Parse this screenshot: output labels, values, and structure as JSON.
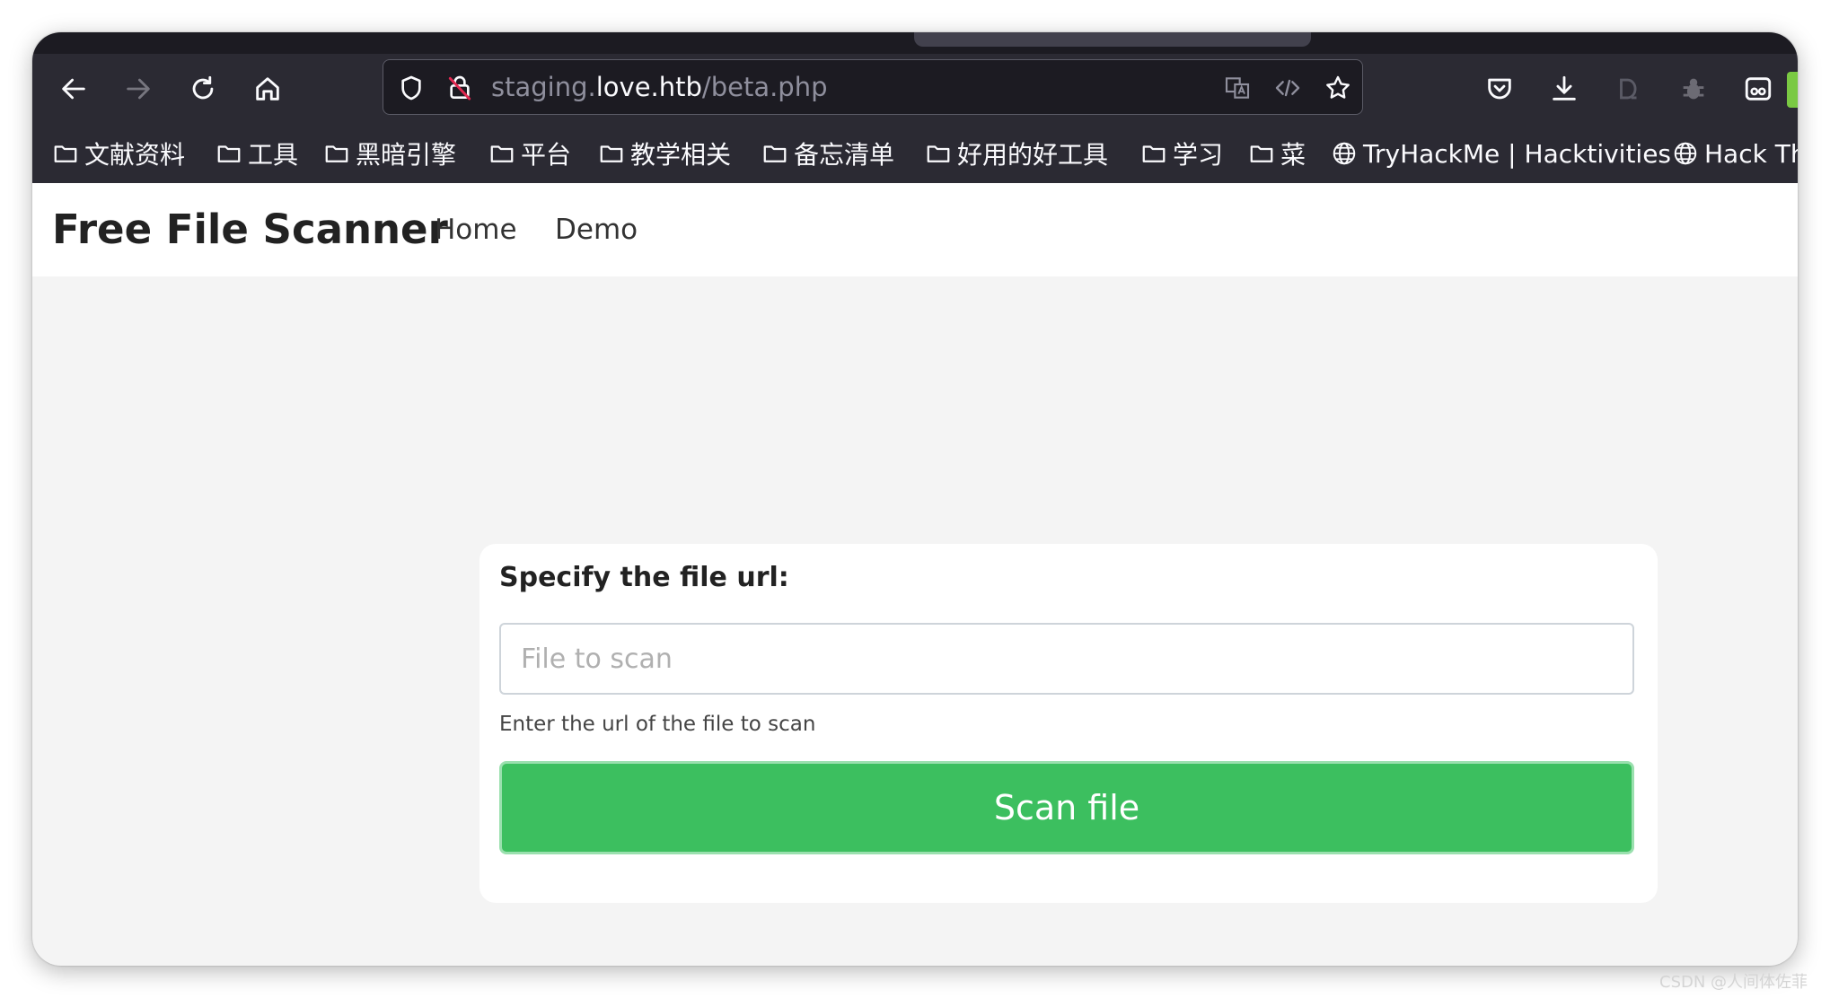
{
  "browser": {
    "url": {
      "prefix": "staging.",
      "domain": "love.htb",
      "path": "/beta.php"
    },
    "bookmarks": [
      {
        "label": "文献资料",
        "icon": "folder-icon"
      },
      {
        "label": "工具",
        "icon": "folder-icon"
      },
      {
        "label": "黑暗引擎",
        "icon": "folder-icon"
      },
      {
        "label": "平台",
        "icon": "folder-icon"
      },
      {
        "label": "教学相关",
        "icon": "folder-icon"
      },
      {
        "label": "备忘清单",
        "icon": "folder-icon"
      },
      {
        "label": "好用的好工具",
        "icon": "folder-icon"
      },
      {
        "label": "学习",
        "icon": "folder-icon"
      },
      {
        "label": "菜",
        "icon": "folder-icon"
      },
      {
        "label": "TryHackMe | Hacktivities",
        "icon": "globe-icon"
      },
      {
        "label": "Hack Th",
        "icon": "globe-icon"
      }
    ]
  },
  "page": {
    "brand": "Free File Scanner",
    "nav": [
      {
        "label": "Home"
      },
      {
        "label": "Demo"
      }
    ],
    "form": {
      "label": "Specify the file url:",
      "input_placeholder": "File to scan",
      "input_value": "",
      "help_text": "Enter the url of the file to scan",
      "submit_label": "Scan file"
    }
  },
  "watermark": "CSDN @人间体佐菲",
  "colors": {
    "browser_chrome": "#2b2a33",
    "urlbar_bg": "#1c1b22",
    "page_bg": "#f4f4f4",
    "button_green": "#3cbf5f"
  }
}
